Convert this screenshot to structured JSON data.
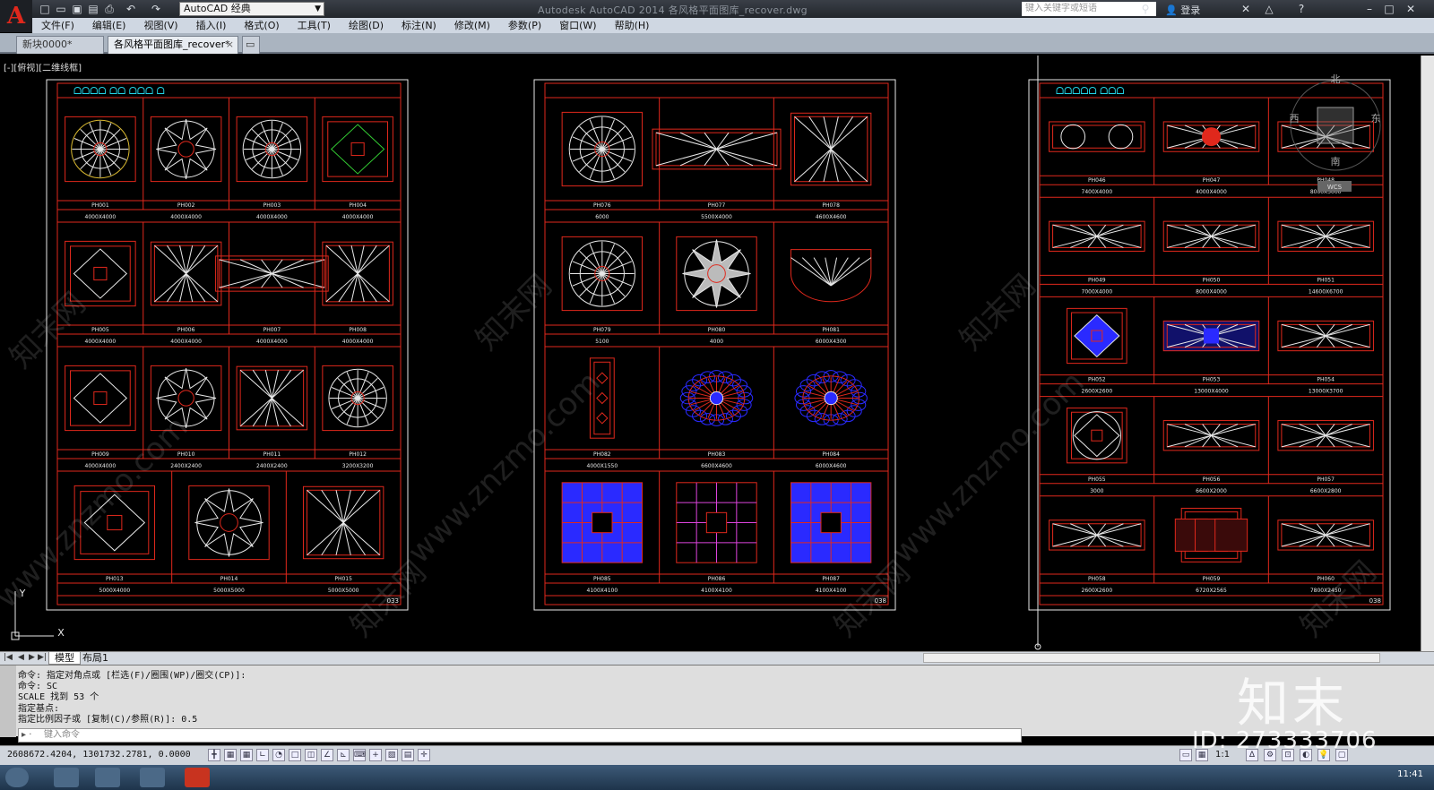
{
  "app": {
    "logo": "A",
    "window_title": "Autodesk AutoCAD 2014    各风格平面图库_recover.dwg",
    "workspace": "AutoCAD 经典",
    "search_placeholder": "键入关键字或短语",
    "login_label": "登录"
  },
  "menu": [
    "文件(F)",
    "编辑(E)",
    "视图(V)",
    "插入(I)",
    "格式(O)",
    "工具(T)",
    "绘图(D)",
    "标注(N)",
    "修改(M)",
    "参数(P)",
    "窗口(W)",
    "帮助(H)"
  ],
  "doc_tabs": [
    {
      "label": "新块0000*"
    },
    {
      "label": "各风格平面图库_recover*"
    }
  ],
  "viewport": {
    "label": "[-][俯视][二维线框]",
    "compass": {
      "north": "北",
      "south": "南",
      "east": "东",
      "west": "西",
      "ucs_label": "WCS"
    },
    "axis_x": "X",
    "axis_y": "Y"
  },
  "sheets": [
    {
      "number": "033",
      "header_text": "ᗝᗝᗝᗝ ᗝᗝ ᗝᗝᗝ ᗝ",
      "rows": [
        {
          "cells": [
            {
              "code": "PH001",
              "size": "4000X4000",
              "motif": "radial"
            },
            {
              "code": "PH002",
              "size": "4000X4000",
              "motif": "star-circle"
            },
            {
              "code": "PH003",
              "size": "4000X4000",
              "motif": "flower-circle"
            },
            {
              "code": "PH004",
              "size": "4000X4000",
              "motif": "diamond-square"
            }
          ]
        },
        {
          "cells": [
            {
              "code": "PH005",
              "size": "4000X4000",
              "motif": "cushion"
            },
            {
              "code": "PH006",
              "size": "4000X4000",
              "motif": "cross-frame"
            },
            {
              "code": "PH007",
              "size": "4000X4000",
              "motif": "x-lattice"
            },
            {
              "code": "PH008",
              "size": "4000X4000",
              "motif": "quad-circles"
            }
          ]
        },
        {
          "cells": [
            {
              "code": "PH009",
              "size": "4000X4000",
              "motif": "diamond-grid"
            },
            {
              "code": "PH010",
              "size": "2400X2400",
              "motif": "star-square"
            },
            {
              "code": "PH011",
              "size": "2400X2400",
              "motif": "nested-square"
            },
            {
              "code": "PH012",
              "size": "3200X3200",
              "motif": "medallion"
            }
          ]
        },
        {
          "cells": [
            {
              "code": "PH013",
              "size": "5000X4000",
              "motif": "rect-diamond"
            },
            {
              "code": "PH014",
              "size": "5000X5000",
              "motif": "star8"
            },
            {
              "code": "PH015",
              "size": "5000X5000",
              "motif": "ring-diamonds"
            }
          ]
        }
      ]
    },
    {
      "number": "038",
      "header_text": "",
      "rows": [
        {
          "cells": [
            {
              "code": "PH076",
              "size": "6000",
              "motif": "round-hatched"
            },
            {
              "code": "PH077",
              "size": "5500X4000",
              "motif": "curved-rect"
            },
            {
              "code": "PH078",
              "size": "4600X4600",
              "motif": "square-frame"
            }
          ]
        },
        {
          "cells": [
            {
              "code": "PH079",
              "size": "5100",
              "motif": "flower-petal"
            },
            {
              "code": "PH080",
              "size": "4000",
              "motif": "compass-star"
            },
            {
              "code": "PH081",
              "size": "6000X4300",
              "motif": "arch"
            }
          ]
        },
        {
          "cells": [
            {
              "code": "PH082",
              "size": "4000X1550",
              "motif": "runner"
            },
            {
              "code": "PH083",
              "size": "6600X4600",
              "motif": "scallop-blue"
            },
            {
              "code": "PH084",
              "size": "6000X4600",
              "motif": "scallop-blue"
            }
          ]
        },
        {
          "cells": [
            {
              "code": "PH085",
              "size": "4100X4100",
              "motif": "blue-grid"
            },
            {
              "code": "PH086",
              "size": "4100X4100",
              "motif": "red-grid"
            },
            {
              "code": "PH087",
              "size": "4100X4100",
              "motif": "blue-grid2"
            }
          ]
        }
      ]
    },
    {
      "number": "038",
      "header_text": "ᗝᗝᗝᗝᗝ ᗝᗝᗝ",
      "rows": [
        {
          "cells": [
            {
              "code": "PH046",
              "size": "7400X4000",
              "motif": "double-circle"
            },
            {
              "code": "PH047",
              "size": "4000X4000",
              "motif": "octagon-red"
            },
            {
              "code": "PH048",
              "size": "8000X5000",
              "motif": "hatched-rect"
            }
          ]
        },
        {
          "cells": [
            {
              "code": "PH049",
              "size": "7000X4000",
              "motif": "diamond-row"
            },
            {
              "code": "PH050",
              "size": "8000X4000",
              "motif": "parallelogram"
            },
            {
              "code": "PH051",
              "size": "14600X6700",
              "motif": "double-lattice"
            }
          ]
        },
        {
          "cells": [
            {
              "code": "PH052",
              "size": "2600X2600",
              "motif": "blue-diamond"
            },
            {
              "code": "PH053",
              "size": "13000X4000",
              "motif": "blue-band"
            },
            {
              "code": "PH054",
              "size": "13000X3700",
              "motif": "weave-band"
            }
          ]
        },
        {
          "cells": [
            {
              "code": "PH055",
              "size": "3000",
              "motif": "circle-diamond"
            },
            {
              "code": "PH056",
              "size": "6600X2000",
              "motif": "oval-band"
            },
            {
              "code": "PH057",
              "size": "6600X2800",
              "motif": "ellipse-lattice"
            }
          ]
        },
        {
          "cells": [
            {
              "code": "PH058",
              "size": "2600X2600",
              "motif": "octagon-frame"
            },
            {
              "code": "PH059",
              "size": "6720X2565",
              "motif": "triple-flower"
            },
            {
              "code": "PH060",
              "size": "7800X2450",
              "motif": "split-band"
            }
          ]
        }
      ]
    }
  ],
  "layout_tabs": [
    "模型",
    "布局1"
  ],
  "command_history": [
    "命令: 指定对角点或 [栏选(F)/圈围(WP)/圈交(CP)]:",
    "命令: SC",
    "SCALE 找到 53 个",
    "指定基点:",
    "指定比例因子或 [复制(C)/参照(R)]: 0.5"
  ],
  "command_placeholder": "键入命令",
  "coordinates": "2608672.4204, 1301732.2781, 0.0000",
  "status_scale": "1:1",
  "clock": "11:41",
  "watermark": {
    "brand": "知末",
    "id": "ID: 273333706",
    "site": "www.znzmo.com",
    "site_cn": "知末网"
  },
  "colors": {
    "red": "#e0281c",
    "blue": "#2a2aff",
    "cyan": "#22d3e6",
    "white": "#e8e8e8"
  }
}
